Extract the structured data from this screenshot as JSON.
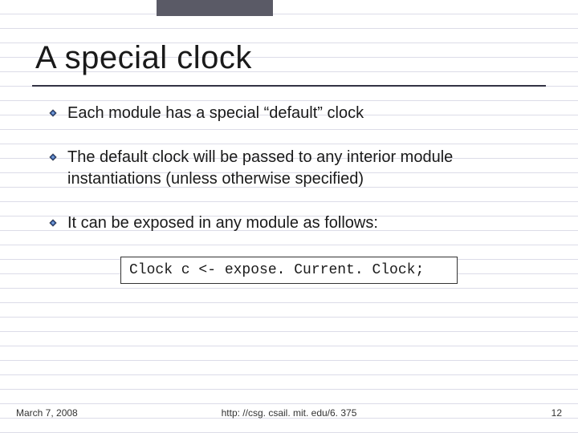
{
  "title": "A special clock",
  "bullets": [
    "Each module has a special “default” clock",
    "The default clock will be passed to any interior module instantiations (unless otherwise specified)",
    "It can be exposed in any module as follows:"
  ],
  "code": "Clock c <- expose. Current. Clock;",
  "footer": {
    "date": "March 7, 2008",
    "url": "http: //csg. csail. mit. edu/6. 375",
    "page": "12"
  }
}
